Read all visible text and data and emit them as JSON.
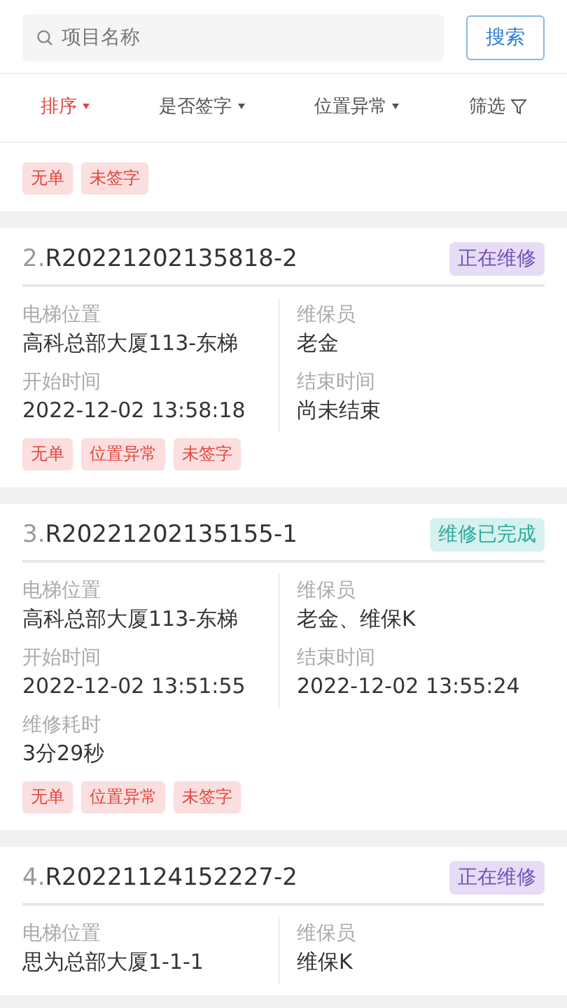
{
  "search": {
    "placeholder": "项目名称",
    "button": "搜索"
  },
  "filters": [
    {
      "label": "排序",
      "kind": "dropdown",
      "selected": true
    },
    {
      "label": "是否签字",
      "kind": "dropdown",
      "selected": false
    },
    {
      "label": "位置异常",
      "kind": "dropdown",
      "selected": false
    },
    {
      "label": "筛选",
      "kind": "filter",
      "selected": false
    }
  ],
  "partial_card": {
    "tags": [
      "无单",
      "未签字"
    ]
  },
  "orders": [
    {
      "index": "2.",
      "code": "R20221202135818-2",
      "status": "正在维修",
      "kind": "repairing",
      "fields": [
        {
          "label": "电梯位置",
          "value": "高科总部大厦113-东梯"
        },
        {
          "label": "维保员",
          "value": "老金"
        },
        {
          "label": "开始时间",
          "value": "2022-12-02 13:58:18"
        },
        {
          "label": "结束时间",
          "value": "尚未结束"
        }
      ],
      "tags": [
        "无单",
        "位置异常",
        "未签字"
      ]
    },
    {
      "index": "3.",
      "code": "R20221202135155-1",
      "status": "维修已完成",
      "kind": "done",
      "fields": [
        {
          "label": "电梯位置",
          "value": "高科总部大厦113-东梯"
        },
        {
          "label": "维保员",
          "value": "老金、维保K"
        },
        {
          "label": "开始时间",
          "value": "2022-12-02 13:51:55"
        },
        {
          "label": "结束时间",
          "value": "2022-12-02 13:55:24"
        },
        {
          "label": "维修耗时",
          "value": "3分29秒"
        }
      ],
      "tags": [
        "无单",
        "位置异常",
        "未签字"
      ]
    },
    {
      "index": "4.",
      "code": "R20221124152227-2",
      "status": "正在维修",
      "kind": "repairing",
      "fields": [
        {
          "label": "电梯位置",
          "value": "思为总部大厦1-1-1"
        },
        {
          "label": "维保员",
          "value": "维保K"
        }
      ]
    }
  ]
}
